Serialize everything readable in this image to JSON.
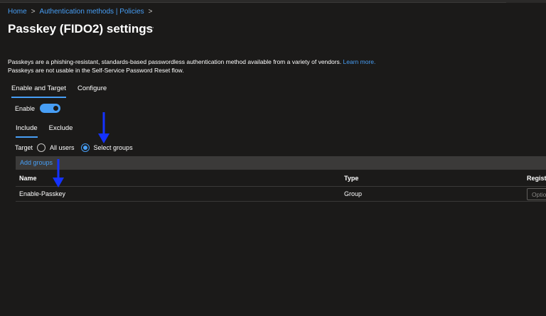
{
  "breadcrumb": {
    "home": "Home",
    "section": "Authentication methods | Policies",
    "separator": ">"
  },
  "page": {
    "title": "Passkey (FIDO2) settings",
    "more": "···"
  },
  "description": {
    "line1": "Passkeys are a phishing-resistant, standards-based passwordless authentication method available from a variety of vendors.",
    "learn_more": "Learn more.",
    "line2": "Passkeys are not usable in the Self-Service Password Reset flow."
  },
  "tabs": [
    {
      "label": "Enable and Target",
      "active": true
    },
    {
      "label": "Configure",
      "active": false
    }
  ],
  "enable": {
    "label": "Enable",
    "on": true
  },
  "subtabs": [
    {
      "label": "Include",
      "active": true
    },
    {
      "label": "Exclude",
      "active": false
    }
  ],
  "target": {
    "label": "Target",
    "options": [
      {
        "label": "All users",
        "selected": false
      },
      {
        "label": "Select groups",
        "selected": true
      }
    ]
  },
  "add_groups": "Add groups",
  "table": {
    "columns": [
      "Name",
      "Type",
      "Regist"
    ],
    "rows": [
      {
        "name": "Enable-Passkey",
        "type": "Group",
        "option": "Optio"
      }
    ]
  },
  "colors": {
    "accent": "#479ef5",
    "background": "#1b1a19",
    "annotation_arrow": "#1432ff"
  },
  "icons": {
    "separator": "chevron-right-icon",
    "more": "more-icon",
    "arrows": "annotation-arrow-icon"
  }
}
